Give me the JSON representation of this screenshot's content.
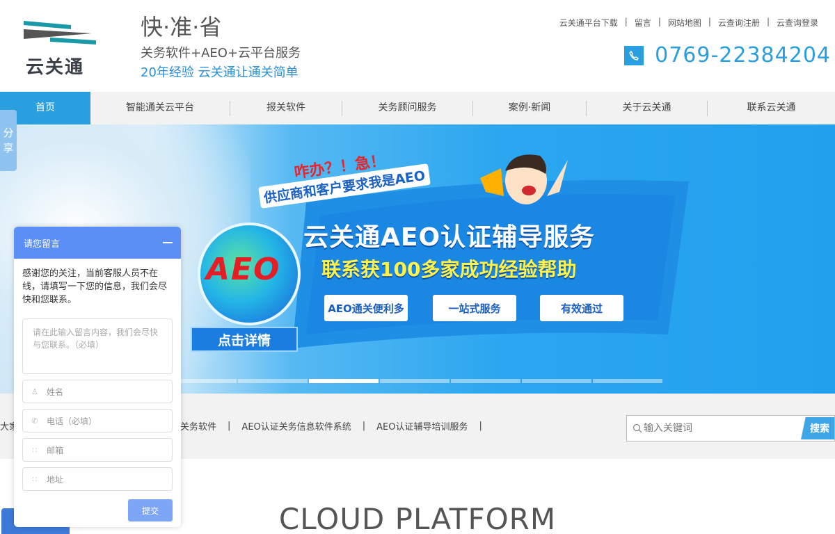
{
  "header": {
    "logo_text": "云关通",
    "slogan_main": "快·准·省",
    "slogan_sub": "关务软件+AEO+云平台服务",
    "slogan_sub2": "20年经验 云关通让通关简单",
    "top_links": [
      "云关通平台下载",
      "留言",
      "网站地图",
      "云查询注册",
      "云查询登录"
    ],
    "phone": "0769-22384204"
  },
  "nav": {
    "items": [
      "首页",
      "智能通关云平台",
      "报关软件",
      "关务顾问服务",
      "案例·新闻",
      "关于云关通",
      "联系云关通"
    ]
  },
  "banner": {
    "exclaim": "咋办？！急！",
    "subtitle": "供应商和客户要求我是AEO",
    "title": "云关通AEO认证辅导服务",
    "tagline": "联系获100多家成功经验帮助",
    "buttons": [
      "AEO通关便利多",
      "一站式服务",
      "有效通过"
    ],
    "badge": "AEO",
    "detail_button": "点击详情",
    "slide_count": 7,
    "active_slide": 3
  },
  "share": {
    "label_line1": "分",
    "label_line2": "享"
  },
  "keywords": {
    "prefix": "大家",
    "links": [
      "期关务软件",
      "AEO认证关务信息软件系统",
      "AEO认证辅导培训服务"
    ]
  },
  "search": {
    "placeholder": "输入关键词",
    "button": "搜索"
  },
  "section": {
    "title": "CLOUD PLATFORM"
  },
  "chat": {
    "title": "请您留言",
    "message": "感谢您的关注，当前客服人员不在线，请填写一下您的信息，我们会尽快和您联系。",
    "textarea_placeholder": "请在此输入留言内容，我们会尽快与您联系。（必填）",
    "name_placeholder": "姓名",
    "phone_placeholder": "电话（必填）",
    "email_placeholder": "邮箱",
    "address_placeholder": "地址",
    "submit": "提交"
  },
  "colors": {
    "accent": "#2a9fe0",
    "chat_header": "#5b8ff5",
    "banner_red": "#e31e25",
    "banner_yellow": "#fff34a"
  }
}
